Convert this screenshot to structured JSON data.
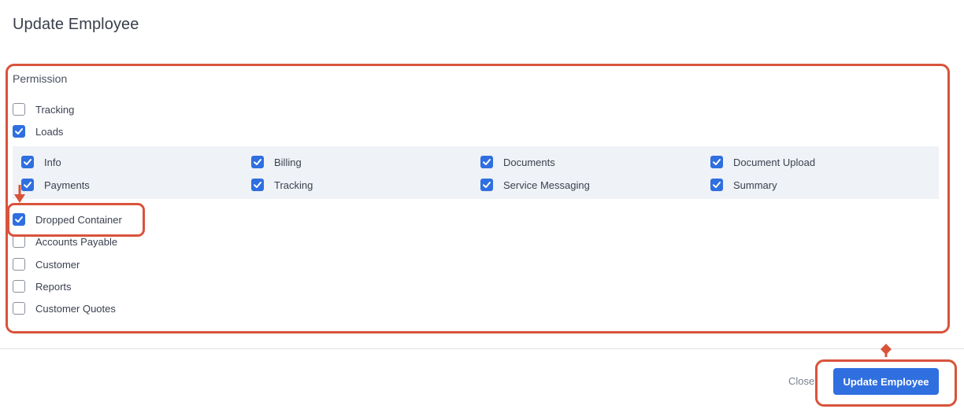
{
  "dialog": {
    "title": "Update Employee"
  },
  "permission": {
    "section_label": "Permission",
    "top_items": [
      {
        "label": "Tracking",
        "checked": false
      },
      {
        "label": "Loads",
        "checked": true
      }
    ],
    "loads_sub_items": [
      {
        "label": "Info",
        "checked": true
      },
      {
        "label": "Billing",
        "checked": true
      },
      {
        "label": "Documents",
        "checked": true
      },
      {
        "label": "Document Upload",
        "checked": true
      },
      {
        "label": "Payments",
        "checked": true
      },
      {
        "label": "Tracking",
        "checked": true
      },
      {
        "label": "Service Messaging",
        "checked": true
      },
      {
        "label": "Summary",
        "checked": true
      }
    ],
    "bottom_items": [
      {
        "label": "Dropped Container",
        "checked": true
      },
      {
        "label": "Accounts Payable",
        "checked": false
      },
      {
        "label": "Customer",
        "checked": false
      },
      {
        "label": "Reports",
        "checked": false
      },
      {
        "label": "Customer Quotes",
        "checked": false
      }
    ]
  },
  "footer": {
    "close_label": "Close",
    "submit_label": "Update Employee"
  },
  "colors": {
    "accent": "#2f6fe0",
    "annotation": "#d9533b"
  }
}
